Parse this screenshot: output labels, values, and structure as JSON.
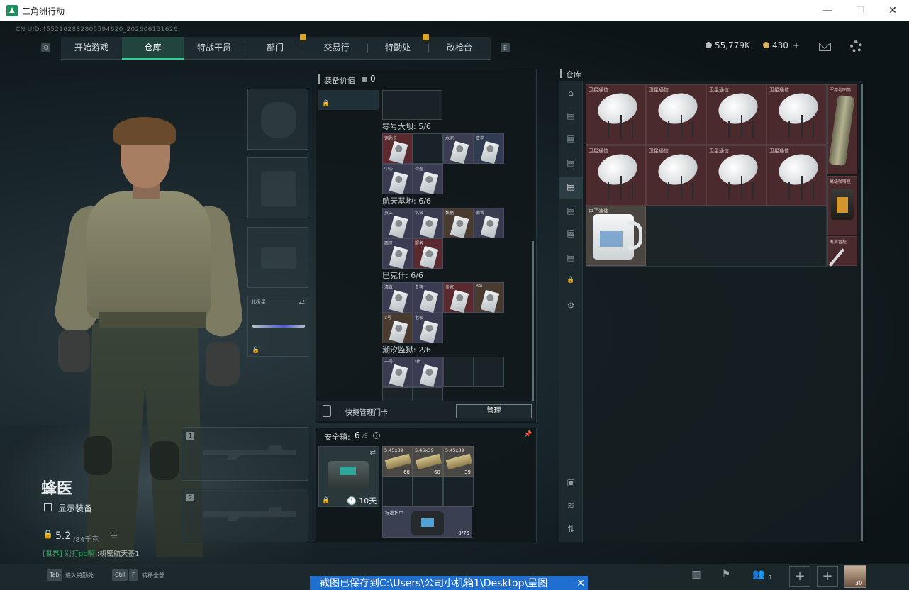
{
  "window": {
    "title": "三角洲行动",
    "minimize": "—",
    "maximize": "☐",
    "close": "✕"
  },
  "uid": "CN UID:4552162882805594620_202606151626",
  "nav": {
    "key_left": "Q",
    "key_right": "E",
    "tabs": [
      "开始游戏",
      "仓库",
      "特战干员",
      "部门",
      "交易行",
      "特勤处",
      "改枪台"
    ],
    "active_tab": "仓库"
  },
  "currency": {
    "coins": "55,779K",
    "tickets": "430",
    "plus": "+",
    "coin_color": "#b8bfc3",
    "ticket_color": "#d9b45a"
  },
  "character": {
    "name": "蜂医",
    "show_gear_label": "显示装备",
    "weight_value": "5.2",
    "weight_max": "/84千克",
    "list_icon": "☰"
  },
  "chat": {
    "channel": "[世界]",
    "user": "别打pp啊",
    "message": ":机密航天基1"
  },
  "equipment": {
    "melee_label": "北极星",
    "slot1": "1",
    "slot2": "2"
  },
  "equip_value": {
    "title": "装备价值",
    "value": "0",
    "sections": [
      {
        "name": "零号大坝: 5/6",
        "items": [
          {
            "label": "钥匙卡",
            "color": "#5a2a2e"
          },
          {
            "label": "",
            "color": ""
          },
          {
            "label": "水泥",
            "color": "#3a3d52"
          },
          {
            "label": "变电",
            "color": "#2f3c52"
          },
          {
            "label": "中心",
            "color": "#3a3d52"
          },
          {
            "label": "检查",
            "color": "#3a3d52"
          }
        ]
      },
      {
        "name": "航天基地: 6/6",
        "items": [
          {
            "label": "员工",
            "color": "#3a3d52"
          },
          {
            "label": "机械",
            "color": "#3a3d52"
          },
          {
            "label": "数据",
            "color": "#4a3b30"
          },
          {
            "label": "宿舍",
            "color": "#3a3d52"
          },
          {
            "label": "西区",
            "color": "#3a3d52"
          },
          {
            "label": "服务",
            "color": "#5a2a2e"
          }
        ]
      },
      {
        "name": "巴克什: 6/6",
        "items": [
          {
            "label": "清真",
            "color": "#3a3d52"
          },
          {
            "label": "贵宾",
            "color": "#3a3d52"
          },
          {
            "label": "皇家",
            "color": "#5a2a2e"
          },
          {
            "label": "Rei",
            "color": "#4a3b30"
          },
          {
            "label": "1号",
            "color": "#4a3b30"
          },
          {
            "label": "老板",
            "color": "#3a3d52"
          }
        ]
      },
      {
        "name": "潮汐监狱: 2/6",
        "items": [
          {
            "label": "一号",
            "color": "#3a3d52"
          },
          {
            "label": "(供",
            "color": "#3a3d52"
          }
        ]
      }
    ]
  },
  "keycard": {
    "label": "快捷管理门卡",
    "button": "管理"
  },
  "safe_box": {
    "title": "安全箱:",
    "count": "6",
    "max": "/9",
    "help": "?",
    "timer": "10天",
    "ammo": [
      {
        "label": "5.45x39",
        "qty": "60"
      },
      {
        "label": "5.45x39",
        "qty": "60"
      },
      {
        "label": "5.45x39",
        "qty": "39"
      }
    ],
    "armor": {
      "label": "标准护甲",
      "durability": "0/75"
    }
  },
  "warehouse": {
    "title": "仓库",
    "sat_items": [
      {
        "label": "卫星通信"
      },
      {
        "label": "卫星通信"
      },
      {
        "label": "卫星通信"
      },
      {
        "label": "卫星通信"
      },
      {
        "label": "卫星通信"
      },
      {
        "label": "卫星通信"
      },
      {
        "label": "卫星通信"
      },
      {
        "label": "卫星通信"
      }
    ],
    "side_items": [
      {
        "label": "军用地图筒"
      },
      {
        "label": "高级咖啡豆"
      },
      {
        "label": "笔声音控"
      }
    ],
    "jug_label": "电子液体"
  },
  "bottom": {
    "tab_key": "Tab",
    "tab_text": "进入特勤处",
    "ctrl_key": "Ctrl",
    "f_key": "F",
    "ctrl_text": "转移全部",
    "friends_count": "1",
    "avatar_badge": "30"
  },
  "toast": {
    "text": "截图已保存到C:\\Users\\公司小机箱1\\Desktop\\呈图",
    "close": "✕"
  }
}
